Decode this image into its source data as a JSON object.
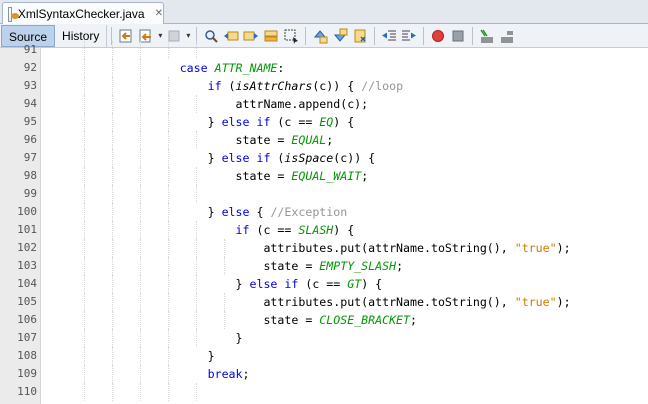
{
  "tab": {
    "title": "XmlSyntaxChecker.java"
  },
  "toolbar": {
    "source_label": "Source",
    "history_label": "History",
    "icons": [
      "last-edit-icon",
      "back-icon",
      "forward-icon",
      "find-icon",
      "find-previous-icon",
      "find-next-icon",
      "toggle-highlight-icon",
      "find-selection-icon",
      "previous-bookmark-icon",
      "next-bookmark-icon",
      "toggle-bookmark-icon",
      "shift-left-icon",
      "shift-right-icon",
      "start-macro-icon",
      "stop-macro-icon",
      "comment-icon",
      "uncomment-icon"
    ]
  },
  "colors": {
    "keyword": "#0000e6",
    "field": "#009900",
    "string": "#ce7b00",
    "comment": "#969696",
    "gutter": "#ebebeb"
  },
  "lines": [
    {
      "num": "91",
      "segs": []
    },
    {
      "num": "92",
      "segs": [
        {
          "t": "                ",
          "c": ""
        },
        {
          "t": "case ",
          "c": "kw"
        },
        {
          "t": "ATTR_NAME",
          "c": "fld"
        },
        {
          "t": ":",
          "c": ""
        }
      ]
    },
    {
      "num": "93",
      "segs": [
        {
          "t": "                    ",
          "c": ""
        },
        {
          "t": "if",
          "c": "kw"
        },
        {
          "t": " (",
          "c": ""
        },
        {
          "t": "isAttrChars",
          "c": "it"
        },
        {
          "t": "(c)) { ",
          "c": ""
        },
        {
          "t": "//loop",
          "c": "cmt"
        }
      ]
    },
    {
      "num": "94",
      "segs": [
        {
          "t": "                        attrName.append(c);",
          "c": ""
        }
      ]
    },
    {
      "num": "95",
      "segs": [
        {
          "t": "                    } ",
          "c": ""
        },
        {
          "t": "else if",
          "c": "kw"
        },
        {
          "t": " (c == ",
          "c": ""
        },
        {
          "t": "EQ",
          "c": "fld"
        },
        {
          "t": ") {",
          "c": ""
        }
      ]
    },
    {
      "num": "96",
      "segs": [
        {
          "t": "                        state = ",
          "c": ""
        },
        {
          "t": "EQUAL",
          "c": "fld"
        },
        {
          "t": ";",
          "c": ""
        }
      ]
    },
    {
      "num": "97",
      "segs": [
        {
          "t": "                    } ",
          "c": ""
        },
        {
          "t": "else if",
          "c": "kw"
        },
        {
          "t": " (",
          "c": ""
        },
        {
          "t": "isSpace",
          "c": "it"
        },
        {
          "t": "(c)) {",
          "c": ""
        }
      ]
    },
    {
      "num": "98",
      "segs": [
        {
          "t": "                        state = ",
          "c": ""
        },
        {
          "t": "EQUAL_WAIT",
          "c": "fld"
        },
        {
          "t": ";",
          "c": ""
        }
      ]
    },
    {
      "num": "99",
      "segs": []
    },
    {
      "num": "100",
      "segs": [
        {
          "t": "                    } ",
          "c": ""
        },
        {
          "t": "else",
          "c": "kw"
        },
        {
          "t": " { ",
          "c": ""
        },
        {
          "t": "//Exception",
          "c": "cmt"
        }
      ]
    },
    {
      "num": "101",
      "segs": [
        {
          "t": "                        ",
          "c": ""
        },
        {
          "t": "if",
          "c": "kw"
        },
        {
          "t": " (c == ",
          "c": ""
        },
        {
          "t": "SLASH",
          "c": "fld"
        },
        {
          "t": ") {",
          "c": ""
        }
      ]
    },
    {
      "num": "102",
      "segs": [
        {
          "t": "                            attributes.put(attrName.toString(), ",
          "c": ""
        },
        {
          "t": "\"true\"",
          "c": "str"
        },
        {
          "t": ");",
          "c": ""
        }
      ]
    },
    {
      "num": "103",
      "segs": [
        {
          "t": "                            state = ",
          "c": ""
        },
        {
          "t": "EMPTY_SLASH",
          "c": "fld"
        },
        {
          "t": ";",
          "c": ""
        }
      ]
    },
    {
      "num": "104",
      "segs": [
        {
          "t": "                        } ",
          "c": ""
        },
        {
          "t": "else if",
          "c": "kw"
        },
        {
          "t": " (c == ",
          "c": ""
        },
        {
          "t": "GT",
          "c": "fld"
        },
        {
          "t": ") {",
          "c": ""
        }
      ]
    },
    {
      "num": "105",
      "segs": [
        {
          "t": "                            attributes.put(attrName.toString(), ",
          "c": ""
        },
        {
          "t": "\"true\"",
          "c": "str"
        },
        {
          "t": ");",
          "c": ""
        }
      ]
    },
    {
      "num": "106",
      "segs": [
        {
          "t": "                            state = ",
          "c": ""
        },
        {
          "t": "CLOSE_BRACKET",
          "c": "fld"
        },
        {
          "t": ";",
          "c": ""
        }
      ]
    },
    {
      "num": "107",
      "segs": [
        {
          "t": "                        }",
          "c": ""
        }
      ]
    },
    {
      "num": "108",
      "segs": [
        {
          "t": "                    }",
          "c": ""
        }
      ]
    },
    {
      "num": "109",
      "segs": [
        {
          "t": "                    ",
          "c": ""
        },
        {
          "t": "break",
          "c": "kw"
        },
        {
          "t": ";",
          "c": ""
        }
      ]
    },
    {
      "num": "110",
      "segs": []
    }
  ]
}
